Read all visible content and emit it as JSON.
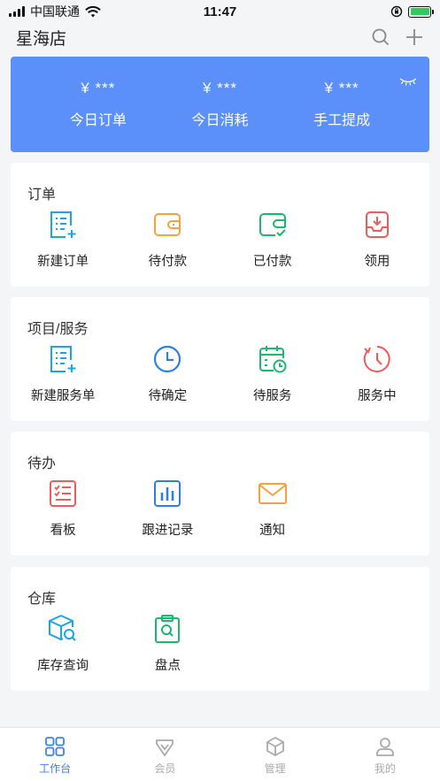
{
  "status_bar": {
    "carrier": "中国联通",
    "time": "11:47"
  },
  "header": {
    "store_name": "星海店",
    "search_icon": "search-icon",
    "add_icon": "plus-icon"
  },
  "stats": {
    "items": [
      {
        "value": "¥ ***",
        "label": "今日订单"
      },
      {
        "value": "¥ ***",
        "label": "今日消耗"
      },
      {
        "value": "¥ ***",
        "label": "手工提成"
      }
    ],
    "toggle_icon": "eye-closed-icon",
    "background_color": "#5b8ff9"
  },
  "sections": [
    {
      "title": "订单",
      "items": [
        {
          "label": "新建订单",
          "icon": "new-order-icon",
          "color": "#1aa5e6"
        },
        {
          "label": "待付款",
          "icon": "wallet-icon",
          "color": "#f5a23c"
        },
        {
          "label": "已付款",
          "icon": "wallet-check-icon",
          "color": "#19b96e"
        },
        {
          "label": "领用",
          "icon": "inbox-download-icon",
          "color": "#f05a5a"
        }
      ]
    },
    {
      "title": "项目/服务",
      "items": [
        {
          "label": "新建服务单",
          "icon": "new-service-icon",
          "color": "#1aa5e6"
        },
        {
          "label": "待确定",
          "icon": "clock-icon",
          "color": "#2f7fe0"
        },
        {
          "label": "待服务",
          "icon": "calendar-clock-icon",
          "color": "#19b96e"
        },
        {
          "label": "服务中",
          "icon": "timer-progress-icon",
          "color": "#f05a5a"
        }
      ]
    },
    {
      "title": "待办",
      "items": [
        {
          "label": "看板",
          "icon": "checklist-icon",
          "color": "#f05a5a"
        },
        {
          "label": "跟进记录",
          "icon": "bar-chart-icon",
          "color": "#2f7fe0"
        },
        {
          "label": "通知",
          "icon": "mail-icon",
          "color": "#f5a23c"
        }
      ]
    },
    {
      "title": "仓库",
      "items": [
        {
          "label": "库存查询",
          "icon": "box-search-icon",
          "color": "#1aa5e6"
        },
        {
          "label": "盘点",
          "icon": "clipboard-search-icon",
          "color": "#19b96e"
        }
      ]
    }
  ],
  "tabbar": {
    "items": [
      {
        "label": "工作台",
        "icon": "grid-icon",
        "active": true
      },
      {
        "label": "会员",
        "icon": "vip-icon",
        "active": false
      },
      {
        "label": "管理",
        "icon": "cube-icon",
        "active": false
      },
      {
        "label": "我的",
        "icon": "user-icon",
        "active": false
      }
    ],
    "active_color": "#3b82f6",
    "inactive_color": "#aaaaaa"
  }
}
